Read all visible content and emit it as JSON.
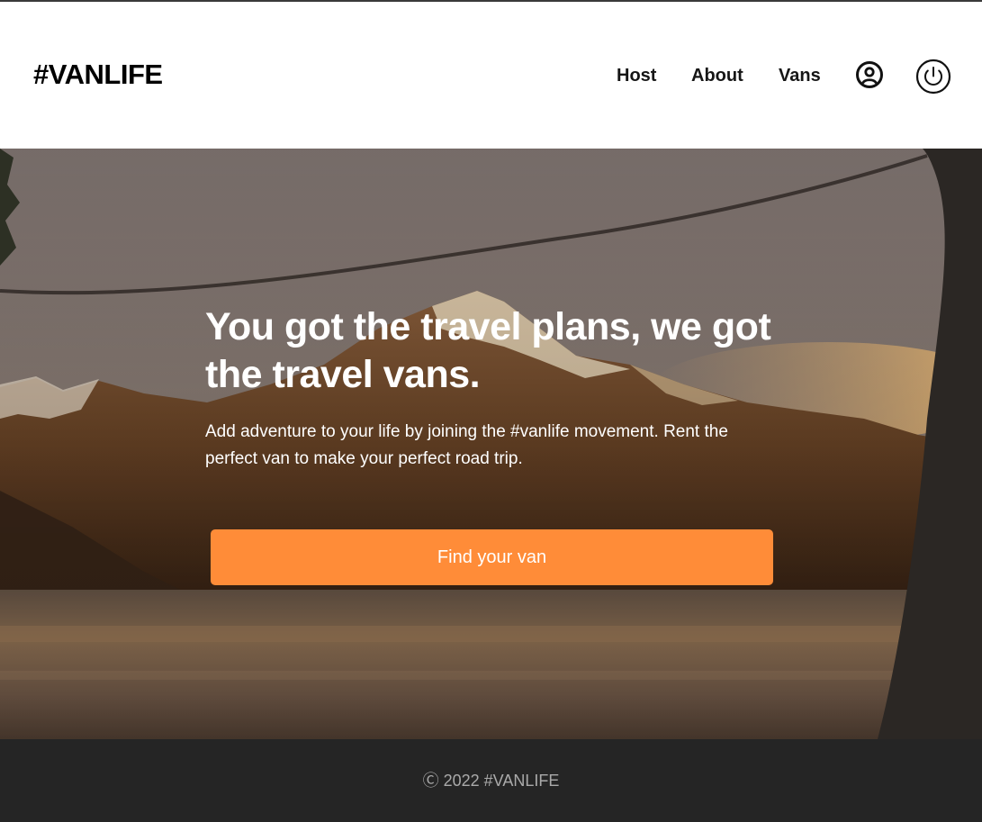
{
  "header": {
    "logo": "#VANLIFE",
    "nav": {
      "host": "Host",
      "about": "About",
      "vans": "Vans"
    },
    "icons": {
      "account": "user-circle-icon",
      "logout": "power-icon"
    }
  },
  "hero": {
    "title": "You got the travel plans, we got the travel vans.",
    "text": "Add adventure to your life by joining the #vanlife movement. Rent the perfect van to make your perfect road trip.",
    "cta_label": "Find your van"
  },
  "footer": {
    "copyright": "Ⓒ 2022 #VANLIFE"
  },
  "colors": {
    "accent": "#FF8C38",
    "footer_bg": "#252525",
    "text_dark": "#161616"
  }
}
